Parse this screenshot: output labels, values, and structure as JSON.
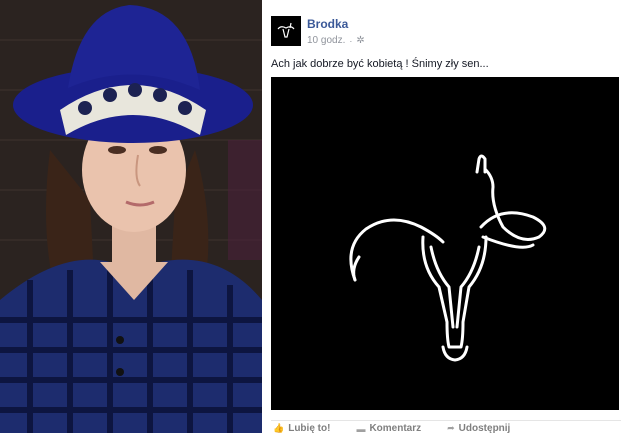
{
  "post": {
    "author": "Brodka",
    "time": "10 godz.",
    "privacy_icon": "gear-icon",
    "text": "Ach jak dobrze być kobietą ! Śnimy zły sen...",
    "image_icon": "uterus-outline-icon",
    "actions": {
      "like": "Lubię to!",
      "comment": "Komentarz",
      "share": "Udostępnij"
    }
  }
}
